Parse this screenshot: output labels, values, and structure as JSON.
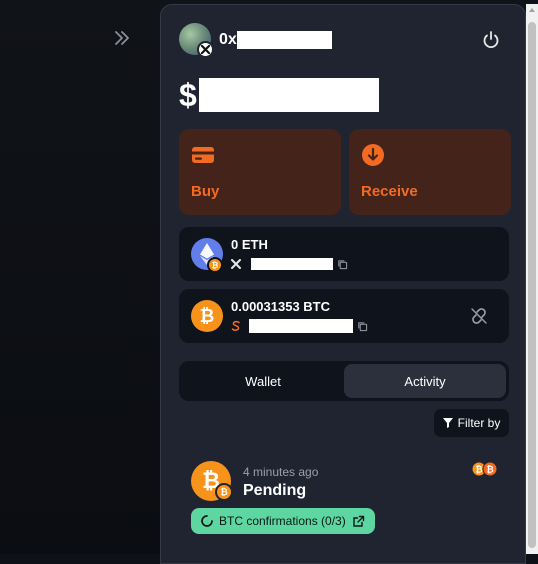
{
  "header": {
    "address_prefix": "0x",
    "balance_prefix": "$"
  },
  "actions": [
    {
      "label": "Buy",
      "icon": "credit-card-icon"
    },
    {
      "label": "Receive",
      "icon": "arrow-down-circle-icon"
    }
  ],
  "assets": [
    {
      "amount": "0 ETH",
      "coin": "ethereum",
      "network_icon": "cross-network-icon"
    },
    {
      "amount": "0.00031353 BTC",
      "coin": "bitcoin",
      "network_icon": "sats-icon"
    }
  ],
  "tabs": [
    {
      "label": "Wallet",
      "active": false
    },
    {
      "label": "Activity",
      "active": true
    }
  ],
  "filter": {
    "label": "Filter by"
  },
  "activity": [
    {
      "time": "4 minutes ago",
      "status": "Pending",
      "confirmations": "BTC confirmations (0/3)"
    }
  ],
  "colors": {
    "panel": "#1f2430",
    "card": "#0f131b",
    "accent": "#f36b22",
    "action_bg": "#44241a",
    "bitcoin": "#f7931a",
    "success": "#5ed6a1"
  }
}
